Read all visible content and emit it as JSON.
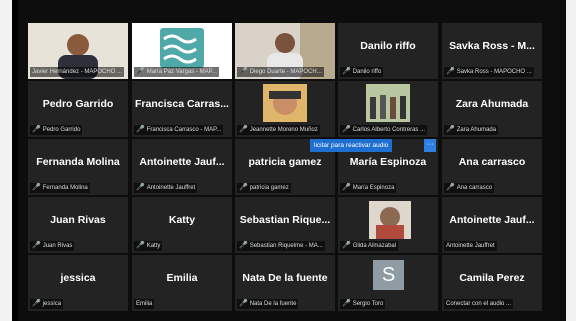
{
  "mute_icon": "mic-muted-icon",
  "tooltip": {
    "text": "licitar para reactivar audio",
    "more": "···"
  },
  "tiles": [
    {
      "name": "",
      "label": "Javier Hernández - MAPOCHO ...",
      "muted": false,
      "video": true,
      "active": true
    },
    {
      "name": "",
      "label": "María Paz Vargas - MAP...",
      "muted": true,
      "video": true
    },
    {
      "name": "",
      "label": "Diego Duarte - MAPOCH...",
      "muted": true,
      "video": true
    },
    {
      "name": "Danilo riffo",
      "label": "Danilo riffo",
      "muted": true
    },
    {
      "name": "Savka Ross - M...",
      "label": "Savka Ross - MAPOCHO ...",
      "muted": true
    },
    {
      "name": "Pedro Garrido",
      "label": "Pedro Garrido",
      "muted": true
    },
    {
      "name": "Francisca Carras...",
      "label": "Francisca Carrasco - MAP...",
      "muted": true
    },
    {
      "name": "",
      "label": "Jeannette Moreno Muñoz",
      "muted": true,
      "video": true
    },
    {
      "name": "",
      "label": "Carlos Alberto Contreras ...",
      "muted": true,
      "video": true
    },
    {
      "name": "Zara Ahumada",
      "label": "Zara Ahumada",
      "muted": true
    },
    {
      "name": "Fernanda Molina",
      "label": "Fernanda Molina",
      "muted": true
    },
    {
      "name": "Antoinette Jauf...",
      "label": "Antoinette Jauffret",
      "muted": true
    },
    {
      "name": "patricia gamez",
      "label": "patricia gamez",
      "muted": true
    },
    {
      "name": "María Espinoza",
      "label": "María Espinoza",
      "muted": true
    },
    {
      "name": "Ana carrasco",
      "label": "Ana carrasco",
      "muted": true
    },
    {
      "name": "Juan Rivas",
      "label": "Juan Rivas",
      "muted": true
    },
    {
      "name": "Katty",
      "label": "Katty",
      "muted": true
    },
    {
      "name": "Sebastian Rique...",
      "label": "Sebastian Riquelme - MA...",
      "muted": true
    },
    {
      "name": "",
      "label": "Glida Almazabal",
      "muted": true,
      "video": true
    },
    {
      "name": "Antoinette Jauf...",
      "label": "Antoinette Jauffret",
      "muted": false
    },
    {
      "name": "jessica",
      "label": "jessica",
      "muted": true
    },
    {
      "name": "Emilia",
      "label": "Emilia",
      "muted": false
    },
    {
      "name": "Nata De la fuente",
      "label": "Nata De la fuente",
      "muted": true
    },
    {
      "name": "",
      "label": "Sergio Toro",
      "muted": true,
      "avatar": "S"
    },
    {
      "name": "Camila Perez",
      "label": "Conectar con el audio ...",
      "muted": false
    }
  ]
}
